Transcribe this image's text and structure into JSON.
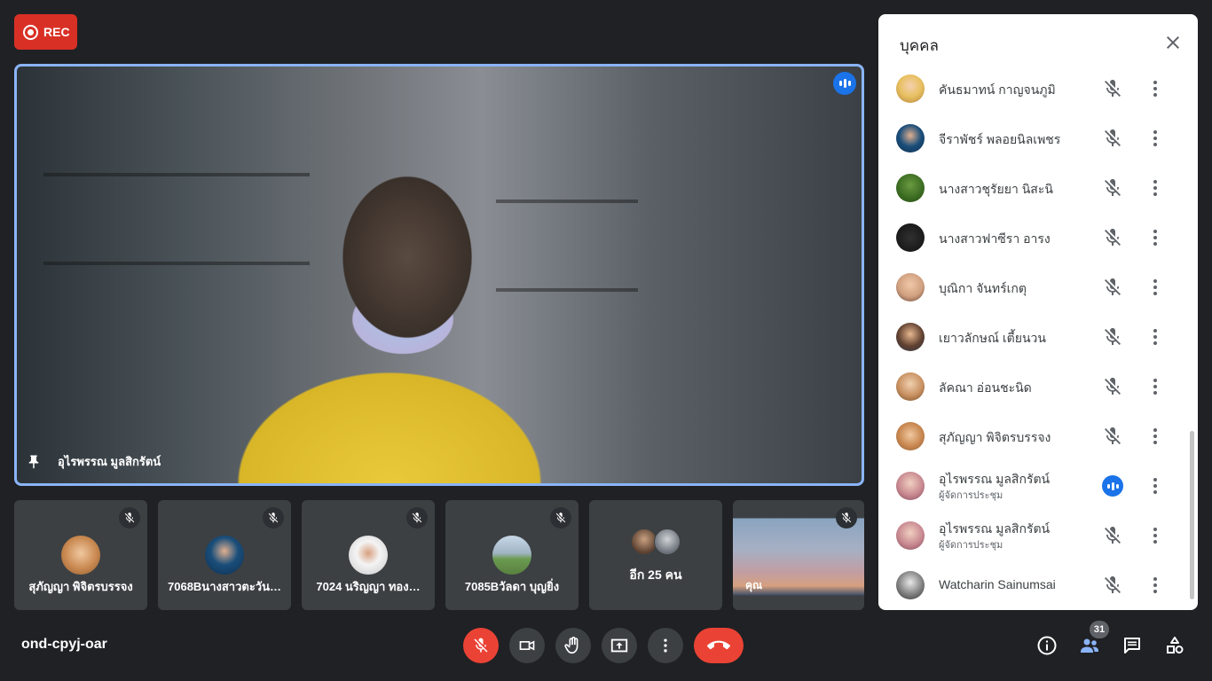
{
  "rec": {
    "label": "REC"
  },
  "main": {
    "pinned_name": "อุไรพรรณ มูลสิกรัตน์"
  },
  "tiles": [
    {
      "name": "สุภัญญา พิจิตรบรรจง",
      "muted": true
    },
    {
      "name": "7068Bนางสาวตะวัน…",
      "muted": true
    },
    {
      "name": "7024 นริญญา ทอง…",
      "muted": true
    },
    {
      "name": "7085Bวัลดา บุญยิ่ง",
      "muted": true
    }
  ],
  "more_tile": {
    "label": "อีก 25 คน"
  },
  "self_tile": {
    "label": "คุณ"
  },
  "panel": {
    "title": "บุคคล",
    "participants": [
      {
        "name": "คันธมาทน์ กาญจนภูมิ",
        "role": "",
        "speaking": false
      },
      {
        "name": "จีราพัชร์ พลอยนิลเพชร",
        "role": "",
        "speaking": false
      },
      {
        "name": "นางสาวชุรัยยา นิสะนิ",
        "role": "",
        "speaking": false
      },
      {
        "name": "นางสาวฟาซีรา อารง",
        "role": "",
        "speaking": false
      },
      {
        "name": "บุณิกา จันทร์เกตุ",
        "role": "",
        "speaking": false
      },
      {
        "name": "เยาวลักษณ์ เตี้ยนวน",
        "role": "",
        "speaking": false
      },
      {
        "name": "ลัคณา อ่อนชะนิด",
        "role": "",
        "speaking": false
      },
      {
        "name": "สุภัญญา พิจิตรบรรจง",
        "role": "",
        "speaking": false
      },
      {
        "name": "อุไรพรรณ มูลสิกรัตน์",
        "role": "ผู้จัดการประชุม",
        "speaking": true
      },
      {
        "name": "อุไรพรรณ มูลสิกรัตน์",
        "role": "ผู้จัดการประชุม",
        "speaking": false
      },
      {
        "name": "Watcharin Sainumsai",
        "role": "",
        "speaking": false
      }
    ]
  },
  "footer": {
    "meeting_code": "ond-cpyj-oar",
    "people_count": "31"
  },
  "colors": {
    "accent_blue": "#1a73e8",
    "rec_red": "#d93025",
    "hangup_red": "#ea4335",
    "background": "#202124"
  }
}
